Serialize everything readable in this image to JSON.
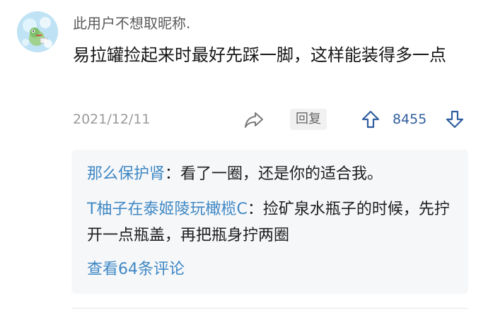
{
  "post": {
    "username": "此用户不想取昵称.",
    "content": "易拉罐捡起来时最好先踩一脚，这样能装得多一点",
    "date": "2021/12/11",
    "reply_label": "回复",
    "vote_count": "8455",
    "icons": {
      "avatar": "avatar-icon",
      "share": "share-icon",
      "upvote": "upvote-icon",
      "downvote": "downvote-icon"
    },
    "colors": {
      "accent": "#3f88c4",
      "vote": "#2f5e9e",
      "meta": "#9a9a9a"
    }
  },
  "replies": {
    "items": [
      {
        "author": "那么保护肾",
        "separator": "：",
        "text": "看了一圈，还是你的适合我。"
      },
      {
        "author": "T柚子在泰姬陵玩橄榄C",
        "separator": "：",
        "text": "捡矿泉水瓶子的时候，先拧开一点瓶盖，再把瓶身拧两圈"
      }
    ],
    "view_more": "查看64条评论"
  }
}
